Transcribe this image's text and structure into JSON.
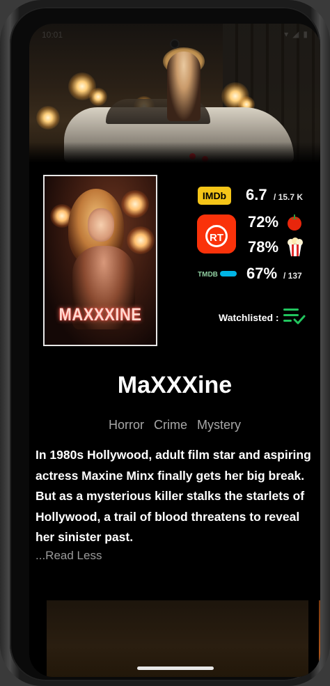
{
  "status_bar": {
    "time": "10:01"
  },
  "movie": {
    "title": "MaXXXine",
    "poster_title": "MAXXXINE",
    "genres": [
      "Horror",
      "Crime",
      "Mystery"
    ],
    "overview": "In 1980s Hollywood, adult film star and aspiring actress Maxine Minx finally gets her big break. But as a mysterious killer stalks the starlets of Hollywood, a trail of blood threatens to reveal her sinister past.",
    "read_less_label": "...Read Less"
  },
  "ratings": {
    "imdb": {
      "badge": "IMDb",
      "score": "6.7",
      "votes": "/ 15.7 K"
    },
    "rotten_tomatoes": {
      "badge": "RT",
      "critics": "72%",
      "audience": "78%"
    },
    "tmdb": {
      "badge": "TMDB",
      "score": "67%",
      "votes": "/ 137"
    }
  },
  "watchlist": {
    "label": "Watchlisted :"
  },
  "colors": {
    "imdb": "#f5c518",
    "rt": "#fa320a",
    "tmdb": "#0d253f",
    "tmdb_accent": "#01b4e4",
    "watchlist_icon": "#22c55e"
  },
  "icons": [
    "camera-icon",
    "tomato-icon",
    "popcorn-icon",
    "watchlist-check-icon"
  ]
}
